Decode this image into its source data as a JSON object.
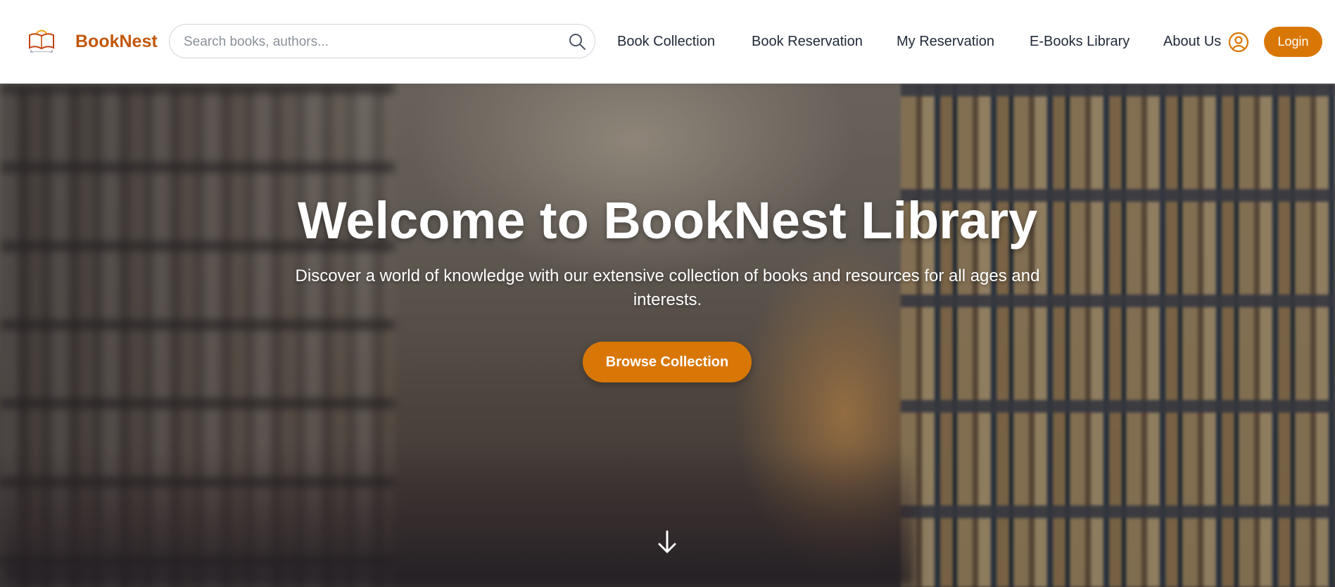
{
  "header": {
    "brand": "BookNest",
    "search": {
      "placeholder": "Search books, authors...",
      "value": ""
    },
    "nav": [
      {
        "label": "Book Collection"
      },
      {
        "label": "Book Reservation"
      },
      {
        "label": "My Reservation"
      },
      {
        "label": "E-Books Library"
      },
      {
        "label": "About Us"
      }
    ],
    "login_label": "Login"
  },
  "hero": {
    "title": "Welcome to BookNest Library",
    "subtitle": "Discover a world of knowledge with our extensive collection of books and resources for all ages and interests.",
    "cta_label": "Browse Collection"
  },
  "icons": {
    "logo": "book-logo-icon",
    "search": "search-icon",
    "user": "user-circle-icon",
    "scroll": "arrow-down-icon"
  },
  "colors": {
    "brand": "#c2570c",
    "accent": "#d97706",
    "nav_text": "#1f2937"
  }
}
